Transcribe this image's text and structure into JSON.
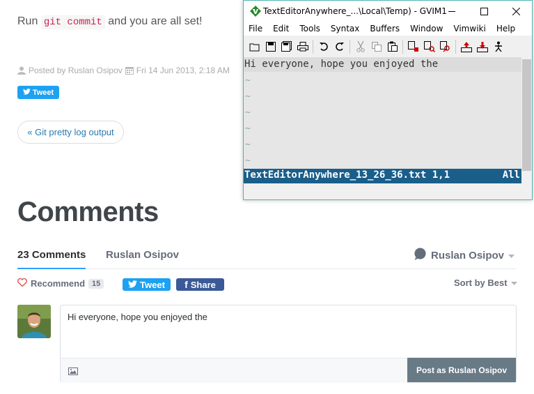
{
  "blog": {
    "run_prefix": "Run",
    "run_code": "git commit",
    "run_suffix": "and you are all set!",
    "posted_by": "Posted by Ruslan Osipov",
    "posted_date": "Fri 14 Jun 2013, 2:18 AM",
    "tweet_label": "Tweet",
    "prev_link": "« Git pretty log output"
  },
  "comments": {
    "title": "Comments",
    "tab_count": "23 Comments",
    "tab_user": "Ruslan Osipov",
    "user_menu": "Ruslan Osipov",
    "recommend_label": "Recommend",
    "recommend_count": "15",
    "tweet_label": "Tweet",
    "share_label": "Share",
    "sort_label": "Sort by Best",
    "draft_text": "Hi everyone, hope you enjoyed the",
    "post_button": "Post as Ruslan Osipov"
  },
  "gvim": {
    "title": "TextEditorAnywhere_...\\Local\\Temp) - GVIM1",
    "menus": [
      "File",
      "Edit",
      "Tools",
      "Syntax",
      "Buffers",
      "Window",
      "Vimwiki",
      "Help"
    ],
    "buffer_line": "Hi everyone, hope you enjoyed the",
    "tilde": "~",
    "status_file": "TextEditorAnywhere_13_26_36.txt 1,1",
    "status_pos": "All"
  },
  "colors": {
    "link": "#2a7ab0",
    "twitter": "#1da1f2",
    "facebook": "#3b5998",
    "tab_accent": "#2e9fff",
    "vim_status": "#1a5e8a",
    "post_button": "#687a86"
  }
}
